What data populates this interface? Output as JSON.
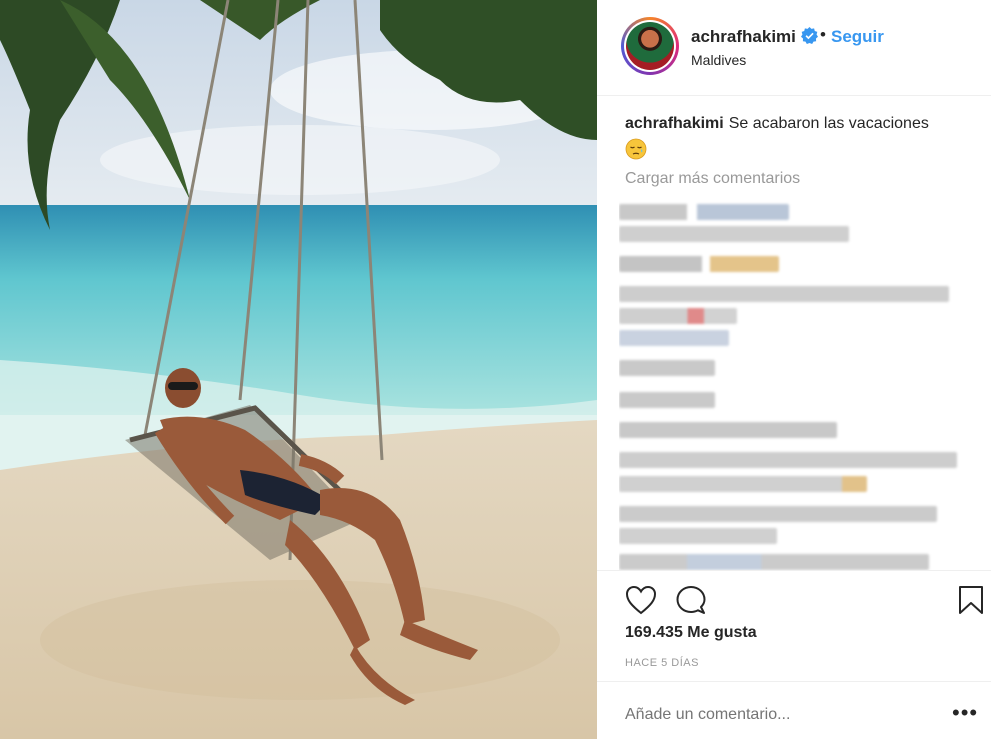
{
  "post": {
    "username": "achrafhakimi",
    "follow_label": "Seguir",
    "separator": "•",
    "location": "Maldives",
    "caption_text": "Se acabaron las vacaciones",
    "caption_emoji": "face-sleepy-emoji",
    "load_more_label": "Cargar más comentarios",
    "likes_text": "169.435 Me gusta",
    "time_ago": "HACE 5 DÍAS",
    "comment_placeholder": "Añade un comentario...",
    "more_label": "•••"
  },
  "icons": {
    "verified": "verified-badge-icon",
    "like": "heart-icon",
    "comment": "speech-bubble-icon",
    "save": "bookmark-icon",
    "more": "ellipsis-icon"
  },
  "colors": {
    "link_blue": "#3897f0",
    "text": "#262626",
    "muted": "#999999",
    "border": "#efefef"
  }
}
